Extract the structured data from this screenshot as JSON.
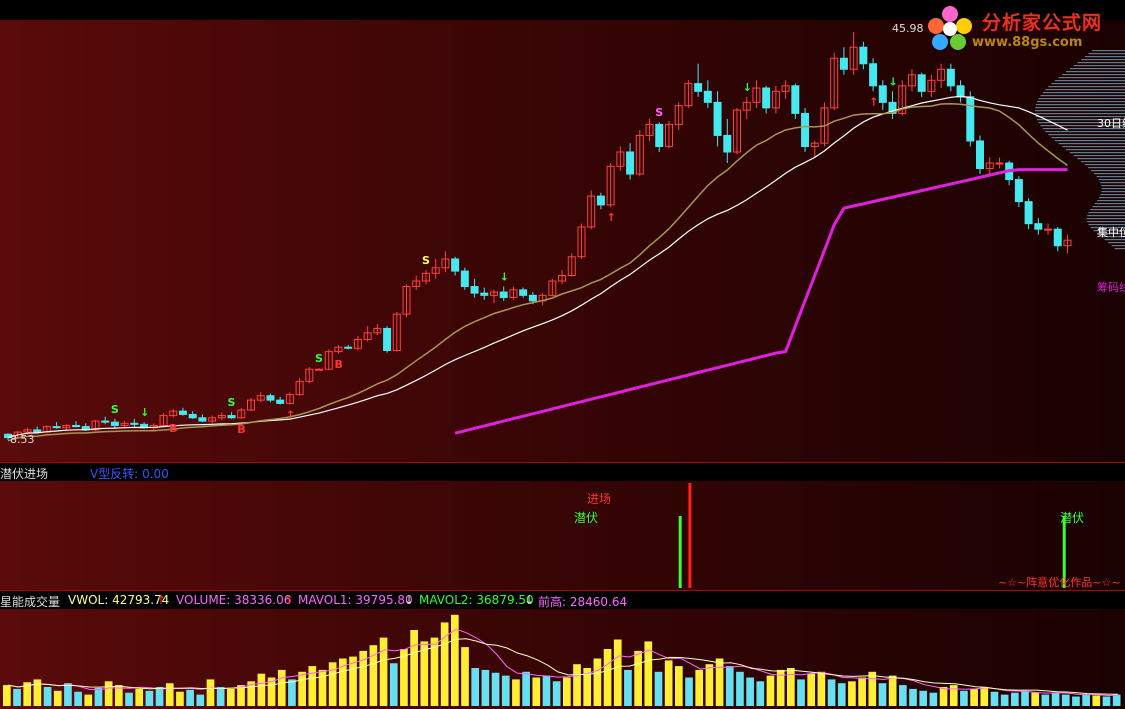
{
  "logo": {
    "title": "分析家公式网",
    "url": "www.88gs.com"
  },
  "main_panel": {
    "high_price_label": "45.98",
    "low_price_label": "8.53",
    "ma30_label": "30日线",
    "concentration_label": "集中位",
    "chip_label": "筹码线"
  },
  "signal_panel": {
    "title": "潜伏进场",
    "indicator_label": "V型反转: 0.00",
    "enter_label": "进场",
    "ambush_label_1": "潜伏",
    "ambush_label_2": "潜伏",
    "credit": "~☆~阵意优化作品~☆~"
  },
  "volume_panel": {
    "title": "星能成交量",
    "vwol": "VWOL: 42793.74",
    "volume": "VOLUME: 38336.06",
    "mavol1": "MAVOL1: 39795.80",
    "mavol2": "MAVOL2: 36879.50",
    "prev_high": "前高: 28460.64",
    "colors": {
      "vwol": "#ffff80",
      "volume": "#ff66ff",
      "mavol1": "#ff66ff",
      "mavol2": "#33ff33",
      "prev_high": "#ff66ff"
    }
  },
  "chart_data": {
    "type": "candlestick",
    "price_range": [
      8.53,
      45.98
    ],
    "candles": [
      [
        9.5,
        9.6,
        9.0,
        9.2
      ],
      [
        9.2,
        9.8,
        9.1,
        9.7
      ],
      [
        9.7,
        10.1,
        9.5,
        9.9
      ],
      [
        9.9,
        10.2,
        9.6,
        9.7
      ],
      [
        9.7,
        10.3,
        9.6,
        10.2
      ],
      [
        10.2,
        10.6,
        10.0,
        10.1
      ],
      [
        10.1,
        10.4,
        9.8,
        10.3
      ],
      [
        10.3,
        10.7,
        10.1,
        10.2
      ],
      [
        10.2,
        10.5,
        9.8,
        9.9
      ],
      [
        9.9,
        10.8,
        9.8,
        10.7
      ],
      [
        10.7,
        11.1,
        10.4,
        10.6
      ],
      [
        10.6,
        10.9,
        10.1,
        10.3
      ],
      [
        10.3,
        10.7,
        10.0,
        10.5
      ],
      [
        10.5,
        10.9,
        10.2,
        10.4
      ],
      [
        10.4,
        10.6,
        10.0,
        10.1
      ],
      [
        10.1,
        10.5,
        9.8,
        10.3
      ],
      [
        10.3,
        11.4,
        10.2,
        11.2
      ],
      [
        11.2,
        11.8,
        11.0,
        11.6
      ],
      [
        11.6,
        11.9,
        11.2,
        11.3
      ],
      [
        11.3,
        11.6,
        10.9,
        11.0
      ],
      [
        11.0,
        11.3,
        10.6,
        10.7
      ],
      [
        10.7,
        11.2,
        10.5,
        11.0
      ],
      [
        11.0,
        11.5,
        10.8,
        11.2
      ],
      [
        11.2,
        11.5,
        10.9,
        11.0
      ],
      [
        11.0,
        11.9,
        10.9,
        11.7
      ],
      [
        11.7,
        12.8,
        11.6,
        12.6
      ],
      [
        12.6,
        13.3,
        12.4,
        13.0
      ],
      [
        13.0,
        13.2,
        12.4,
        12.6
      ],
      [
        12.6,
        12.9,
        12.2,
        12.3
      ],
      [
        12.3,
        13.3,
        12.2,
        13.1
      ],
      [
        13.1,
        14.6,
        13.0,
        14.3
      ],
      [
        14.3,
        15.6,
        14.1,
        15.4
      ],
      [
        15.4,
        15.5,
        15.3,
        15.4
      ],
      [
        15.4,
        17.2,
        15.3,
        17.0
      ],
      [
        17.0,
        17.6,
        16.8,
        17.4
      ],
      [
        17.4,
        17.6,
        17.2,
        17.3
      ],
      [
        17.3,
        18.4,
        17.1,
        18.1
      ],
      [
        18.1,
        19.3,
        17.9,
        18.7
      ],
      [
        18.7,
        19.5,
        18.5,
        19.1
      ],
      [
        19.1,
        19.3,
        16.9,
        17.1
      ],
      [
        17.1,
        20.6,
        17.0,
        20.4
      ],
      [
        20.4,
        23.1,
        20.1,
        22.9
      ],
      [
        22.9,
        23.9,
        22.6,
        23.4
      ],
      [
        23.4,
        24.4,
        23.1,
        24.1
      ],
      [
        24.1,
        25.4,
        23.6,
        24.6
      ],
      [
        24.6,
        26.1,
        24.2,
        25.4
      ],
      [
        25.4,
        25.6,
        23.9,
        24.3
      ],
      [
        24.3,
        24.6,
        22.6,
        22.9
      ],
      [
        22.9,
        23.6,
        21.9,
        22.3
      ],
      [
        22.3,
        22.8,
        21.7,
        22.1
      ],
      [
        22.1,
        22.6,
        21.4,
        22.4
      ],
      [
        22.4,
        22.9,
        21.6,
        21.9
      ],
      [
        21.9,
        22.9,
        21.7,
        22.6
      ],
      [
        22.6,
        22.8,
        21.9,
        22.1
      ],
      [
        22.1,
        22.4,
        21.3,
        21.6
      ],
      [
        21.6,
        22.3,
        21.2,
        22.1
      ],
      [
        22.1,
        23.6,
        22.0,
        23.4
      ],
      [
        23.4,
        24.4,
        23.1,
        23.9
      ],
      [
        23.9,
        25.9,
        23.8,
        25.6
      ],
      [
        25.6,
        28.6,
        25.4,
        28.3
      ],
      [
        28.3,
        31.6,
        28.1,
        31.1
      ],
      [
        31.1,
        31.4,
        29.9,
        30.3
      ],
      [
        30.3,
        34.1,
        30.1,
        33.8
      ],
      [
        33.8,
        35.6,
        33.4,
        35.1
      ],
      [
        35.1,
        35.9,
        32.6,
        33.1
      ],
      [
        33.1,
        37.1,
        32.9,
        36.6
      ],
      [
        36.6,
        38.1,
        36.1,
        37.6
      ],
      [
        37.6,
        37.8,
        35.1,
        35.6
      ],
      [
        35.6,
        37.9,
        35.4,
        37.6
      ],
      [
        37.6,
        39.6,
        37.1,
        39.3
      ],
      [
        39.3,
        41.6,
        39.1,
        41.3
      ],
      [
        41.3,
        43.1,
        40.1,
        40.6
      ],
      [
        40.6,
        41.6,
        39.1,
        39.6
      ],
      [
        39.6,
        40.6,
        35.6,
        36.6
      ],
      [
        36.6,
        38.1,
        34.1,
        35.1
      ],
      [
        35.1,
        39.1,
        34.9,
        38.9
      ],
      [
        38.9,
        40.1,
        38.1,
        39.6
      ],
      [
        39.6,
        41.6,
        39.1,
        40.9
      ],
      [
        40.9,
        41.1,
        38.6,
        39.1
      ],
      [
        39.1,
        41.1,
        38.6,
        40.6
      ],
      [
        40.6,
        41.6,
        39.9,
        41.1
      ],
      [
        41.1,
        41.3,
        38.1,
        38.6
      ],
      [
        38.6,
        39.1,
        35.1,
        35.6
      ],
      [
        35.6,
        36.1,
        34.6,
        35.9
      ],
      [
        35.9,
        39.6,
        35.6,
        39.1
      ],
      [
        39.1,
        44.1,
        38.9,
        43.6
      ],
      [
        43.6,
        44.6,
        42.1,
        42.6
      ],
      [
        42.6,
        45.98,
        42.1,
        44.6
      ],
      [
        44.6,
        45.1,
        42.6,
        43.1
      ],
      [
        43.1,
        43.6,
        40.6,
        41.1
      ],
      [
        41.1,
        41.6,
        38.9,
        39.6
      ],
      [
        39.6,
        40.6,
        38.1,
        38.6
      ],
      [
        38.6,
        41.6,
        38.4,
        41.1
      ],
      [
        41.1,
        42.6,
        40.6,
        42.1
      ],
      [
        42.1,
        42.3,
        40.1,
        40.6
      ],
      [
        40.6,
        42.1,
        40.1,
        41.6
      ],
      [
        41.6,
        43.1,
        40.9,
        42.6
      ],
      [
        42.6,
        43.1,
        40.6,
        41.1
      ],
      [
        41.1,
        41.6,
        39.6,
        40.1
      ],
      [
        40.1,
        40.6,
        35.6,
        36.1
      ],
      [
        36.1,
        36.6,
        33.1,
        33.6
      ],
      [
        33.6,
        34.6,
        32.9,
        34.1
      ],
      [
        34.1,
        34.6,
        33.6,
        34.1
      ],
      [
        34.1,
        34.3,
        32.1,
        32.6
      ],
      [
        32.6,
        32.9,
        30.1,
        30.6
      ],
      [
        30.6,
        30.9,
        28.1,
        28.6
      ],
      [
        28.6,
        29.1,
        27.6,
        28.1
      ],
      [
        28.1,
        28.6,
        27.6,
        28.1
      ],
      [
        28.1,
        28.3,
        26.1,
        26.6
      ],
      [
        26.6,
        27.6,
        25.9,
        27.1
      ]
    ],
    "volume_bars": [
      [
        22,
        1
      ],
      [
        18,
        0
      ],
      [
        25,
        1
      ],
      [
        28,
        1
      ],
      [
        20,
        0
      ],
      [
        16,
        1
      ],
      [
        24,
        0
      ],
      [
        15,
        0
      ],
      [
        12,
        1
      ],
      [
        19,
        0
      ],
      [
        26,
        1
      ],
      [
        22,
        1
      ],
      [
        14,
        0
      ],
      [
        18,
        1
      ],
      [
        16,
        0
      ],
      [
        20,
        0
      ],
      [
        24,
        1
      ],
      [
        15,
        1
      ],
      [
        17,
        0
      ],
      [
        12,
        0
      ],
      [
        28,
        1
      ],
      [
        20,
        0
      ],
      [
        18,
        1
      ],
      [
        22,
        1
      ],
      [
        26,
        1
      ],
      [
        34,
        1
      ],
      [
        30,
        1
      ],
      [
        38,
        1
      ],
      [
        28,
        0
      ],
      [
        36,
        1
      ],
      [
        42,
        1
      ],
      [
        38,
        1
      ],
      [
        46,
        1
      ],
      [
        50,
        1
      ],
      [
        52,
        1
      ],
      [
        58,
        1
      ],
      [
        64,
        1
      ],
      [
        72,
        1
      ],
      [
        45,
        0
      ],
      [
        60,
        1
      ],
      [
        80,
        1
      ],
      [
        68,
        1
      ],
      [
        72,
        1
      ],
      [
        88,
        1
      ],
      [
        96,
        1
      ],
      [
        62,
        1
      ],
      [
        40,
        0
      ],
      [
        38,
        0
      ],
      [
        35,
        0
      ],
      [
        32,
        0
      ],
      [
        28,
        1
      ],
      [
        36,
        0
      ],
      [
        30,
        1
      ],
      [
        32,
        0
      ],
      [
        26,
        0
      ],
      [
        30,
        1
      ],
      [
        44,
        1
      ],
      [
        40,
        1
      ],
      [
        50,
        1
      ],
      [
        60,
        1
      ],
      [
        70,
        1
      ],
      [
        38,
        0
      ],
      [
        58,
        1
      ],
      [
        68,
        1
      ],
      [
        36,
        0
      ],
      [
        48,
        1
      ],
      [
        42,
        1
      ],
      [
        30,
        0
      ],
      [
        38,
        1
      ],
      [
        44,
        1
      ],
      [
        50,
        1
      ],
      [
        42,
        0
      ],
      [
        36,
        0
      ],
      [
        30,
        0
      ],
      [
        26,
        0
      ],
      [
        32,
        1
      ],
      [
        38,
        1
      ],
      [
        40,
        1
      ],
      [
        28,
        0
      ],
      [
        34,
        1
      ],
      [
        36,
        1
      ],
      [
        28,
        0
      ],
      [
        24,
        0
      ],
      [
        26,
        1
      ],
      [
        30,
        1
      ],
      [
        36,
        1
      ],
      [
        24,
        0
      ],
      [
        32,
        1
      ],
      [
        22,
        0
      ],
      [
        18,
        0
      ],
      [
        16,
        0
      ],
      [
        14,
        0
      ],
      [
        20,
        1
      ],
      [
        22,
        1
      ],
      [
        16,
        0
      ],
      [
        18,
        1
      ],
      [
        20,
        1
      ],
      [
        15,
        0
      ],
      [
        12,
        0
      ],
      [
        14,
        0
      ],
      [
        16,
        0
      ],
      [
        14,
        1
      ],
      [
        12,
        0
      ],
      [
        14,
        0
      ],
      [
        12,
        0
      ],
      [
        10,
        0
      ],
      [
        12,
        0
      ],
      [
        11,
        1
      ],
      [
        10,
        0
      ],
      [
        12,
        0
      ]
    ],
    "signals": [
      {
        "pos": 69,
        "type": "ambush",
        "height": 72
      },
      {
        "pos": 70,
        "type": "enter",
        "height": 105
      },
      {
        "pos": 126,
        "type": "ambush",
        "height": 72
      }
    ]
  }
}
